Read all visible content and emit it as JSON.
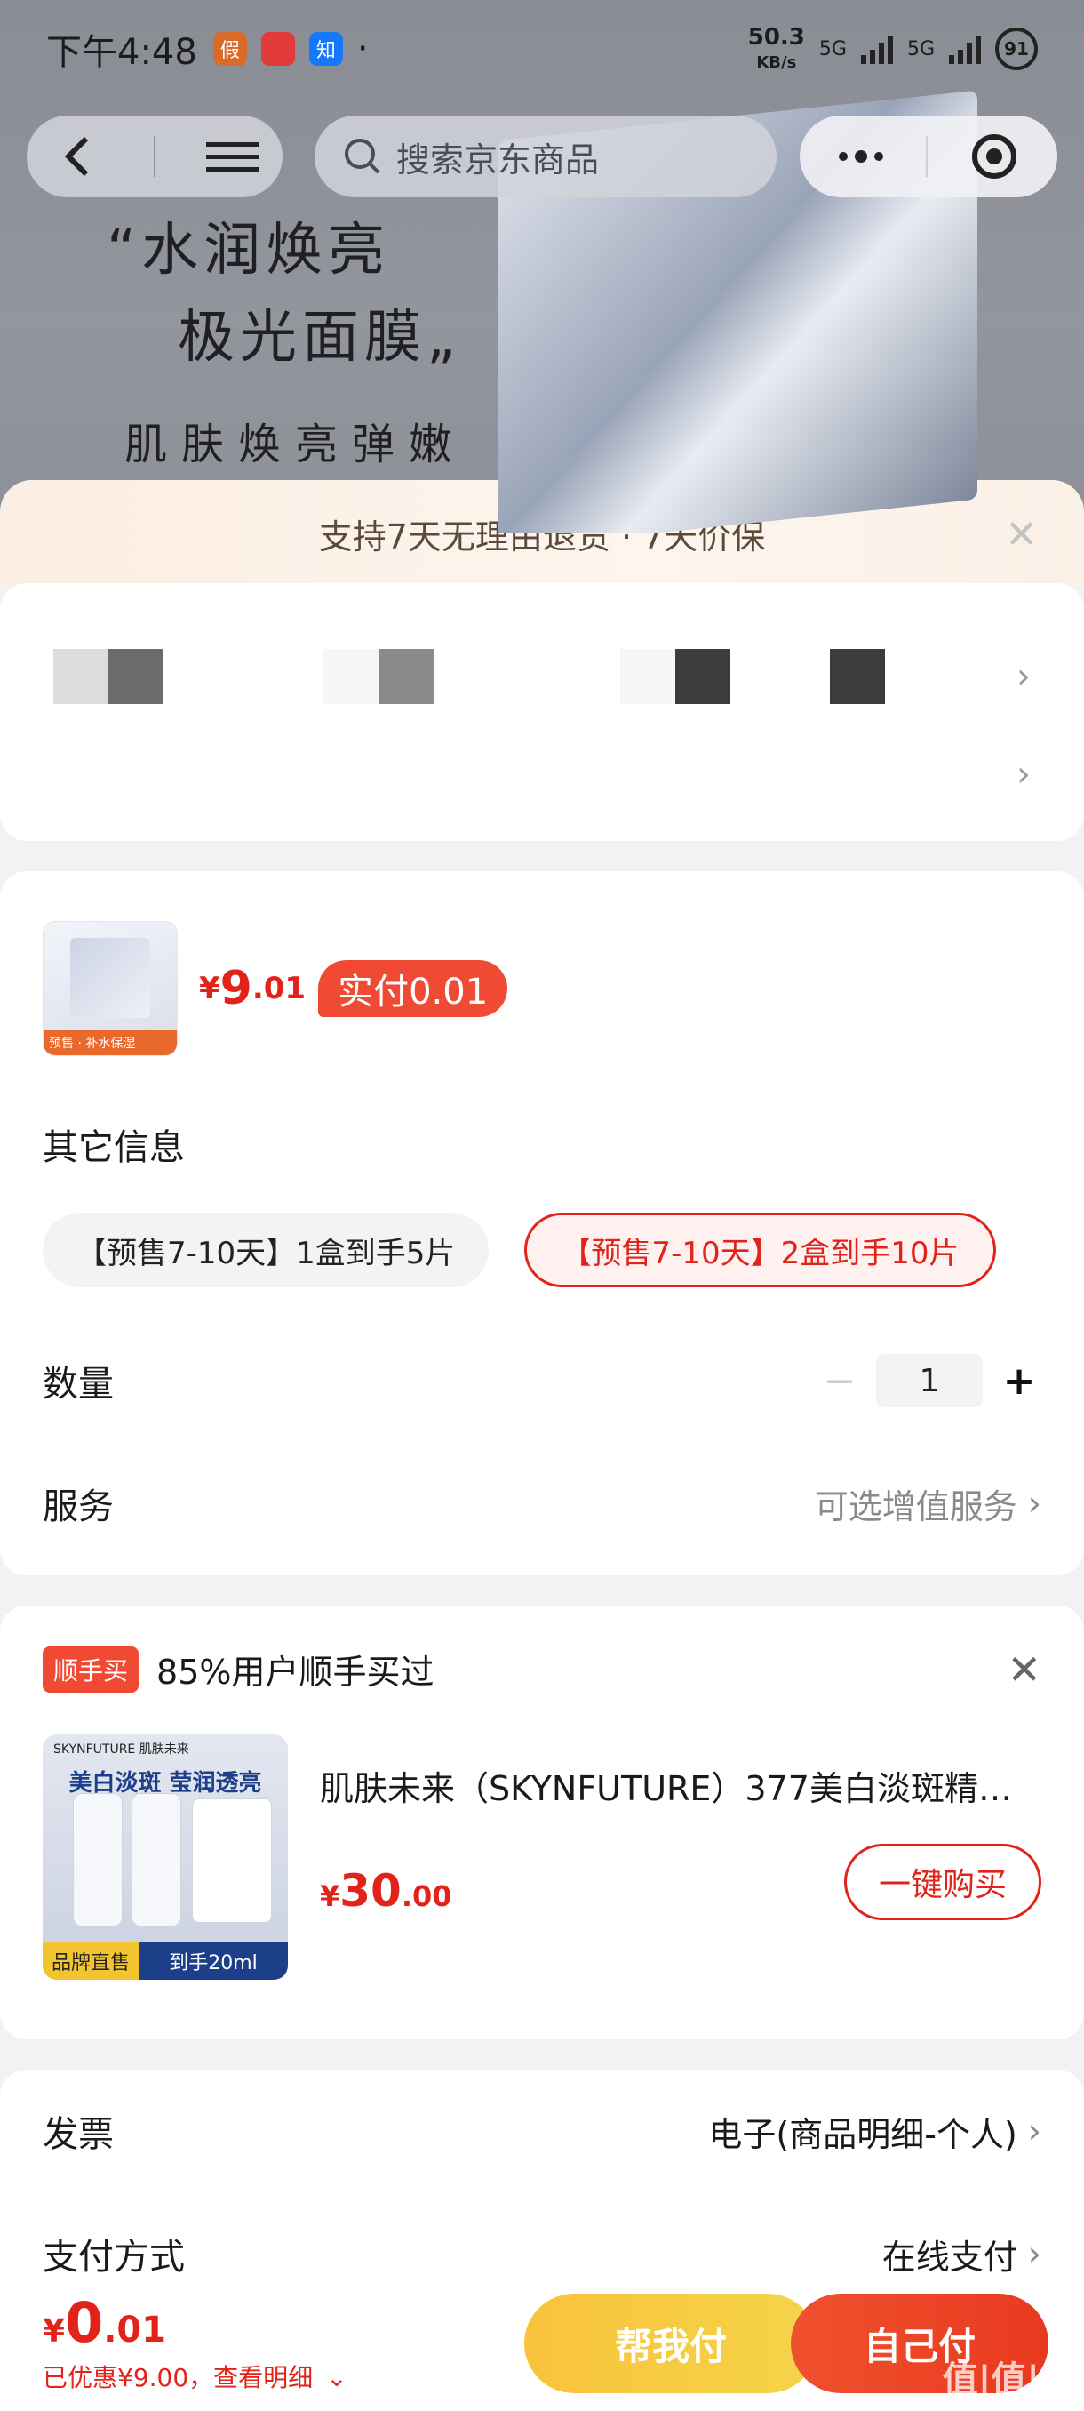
{
  "status_bar": {
    "time": "下午4:48",
    "app_icons": [
      "假",
      "",
      "知",
      "·"
    ],
    "net_speed": "50.3",
    "net_unit": "KB/s",
    "sig1": "5G",
    "sig2": "5G",
    "battery": "91"
  },
  "nav": {
    "search_placeholder": "搜索京东商品"
  },
  "promo": {
    "line1": "“水润焕亮",
    "line2": "极光面膜„",
    "line3": "肌肤焕亮弹嫩"
  },
  "notice": {
    "text": "支持7天无理由退货 · 7天价保"
  },
  "product": {
    "thumb_tag": "预售 · 补水保湿",
    "price_symbol": "¥",
    "price_int": "9",
    "price_dec": ".01",
    "paid_badge": "实付0.01"
  },
  "other_info": {
    "title": "其它信息",
    "options": [
      "【预售7-10天】1盒到手5片",
      "【预售7-10天】2盒到手10片"
    ]
  },
  "quantity": {
    "label": "数量",
    "minus": "−",
    "value": "1",
    "plus": "+"
  },
  "service": {
    "label": "服务",
    "value": "可选增值服务"
  },
  "reco": {
    "tag": "顺手买",
    "headline": "85%用户顺手买过",
    "img_brand": "SKYNFUTURE 肌肤未来",
    "img_headline": "美白淡斑 莹润透亮",
    "img_left": "品牌直售",
    "img_right": "到手20ml",
    "title": "肌肤未来（SKYNFUTURE）377美白淡斑精…",
    "price_symbol": "¥",
    "price_int": "30",
    "price_dec": ".00",
    "buy_button": "一键购买"
  },
  "invoice": {
    "label": "发票",
    "value": "电子(商品明细-个人)"
  },
  "payment": {
    "label": "支付方式",
    "value": "在线支付"
  },
  "bottom": {
    "total_symbol": "¥",
    "total_int": "0",
    "total_dec": ".01",
    "saved_text": "已优惠¥9.00，查看明细",
    "help_pay": "帮我付",
    "self_pay": "自己付",
    "watermark": "值|值|值"
  }
}
